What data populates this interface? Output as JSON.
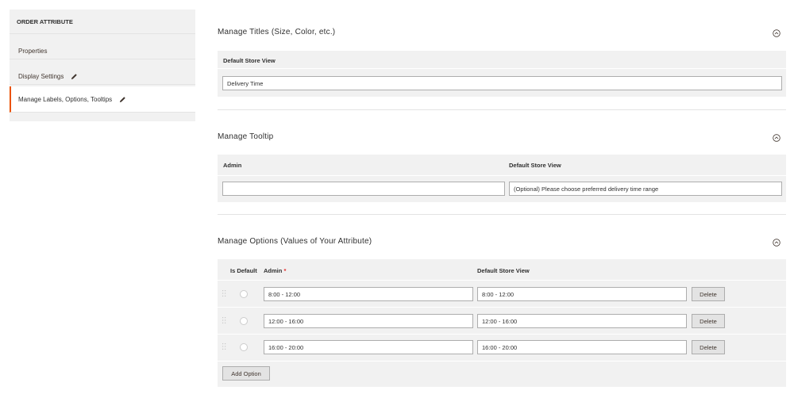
{
  "sidebar": {
    "title": "ORDER ATTRIBUTE",
    "items": [
      {
        "label": "Properties"
      },
      {
        "label": "Display Settings"
      },
      {
        "label": "Manage Labels, Options, Tooltips"
      }
    ]
  },
  "titles_section": {
    "title": "Manage Titles (Size, Color, etc.)",
    "column_header": "Default Store View",
    "value": "Delivery Time"
  },
  "tooltip_section": {
    "title": "Manage Tooltip",
    "col_admin": "Admin",
    "col_store": "Default Store View",
    "admin_value": "",
    "store_value": "(Optional) Please choose preferred delivery time range"
  },
  "options_section": {
    "title": "Manage Options (Values of Your Attribute)",
    "col_default": "Is Default",
    "col_admin": "Admin",
    "required_mark": "*",
    "col_store": "Default Store View",
    "rows": [
      {
        "admin": "8:00 - 12:00",
        "store": "8:00 - 12:00",
        "delete_label": "Delete"
      },
      {
        "admin": "12:00 - 16:00",
        "store": "12:00 - 16:00",
        "delete_label": "Delete"
      },
      {
        "admin": "16:00 - 20:00",
        "store": "16:00 - 20:00",
        "delete_label": "Delete"
      }
    ],
    "add_option_label": "Add Option"
  },
  "icons": {
    "pencil": "pencil-icon",
    "collapse": "chevron-up-circle-icon",
    "drag": "drag-handle-icon"
  },
  "colors": {
    "accent": "#eb5202",
    "required": "#e22626"
  }
}
